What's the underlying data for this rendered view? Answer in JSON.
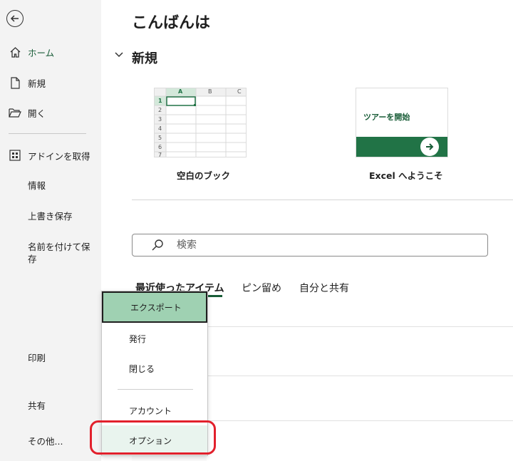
{
  "sidebar": {
    "home_label": "ホーム",
    "new_label": "新規",
    "open_label": "開く",
    "addins_label": "アドインを取得",
    "info_label": "情報",
    "save_label": "上書き保存",
    "save_as_label": "名前を付けて保存",
    "print_label": "印刷",
    "share_label": "共有",
    "more_label": "その他..."
  },
  "main": {
    "greeting": "こんばんは",
    "new_section_title": "新規",
    "templates": [
      {
        "label": "空白のブック"
      },
      {
        "label": "Excel へようこそ",
        "thumb_text": "ツアーを開始"
      }
    ],
    "sheet_columns": [
      "A",
      "B",
      "C"
    ],
    "sheet_rows": [
      "1",
      "2",
      "3",
      "4",
      "5",
      "6",
      "7"
    ],
    "search_placeholder": "検索",
    "tabs": [
      "最近使ったアイテム",
      "ピン留め",
      "自分と共有"
    ]
  },
  "menu": {
    "items": [
      "エクスポート",
      "発行",
      "閉じる",
      "アカウント",
      "オプション"
    ],
    "selected": "エクスポート"
  },
  "colors": {
    "accent": "#185c37",
    "selected_bg": "#9fd1b2",
    "annotation": "#e2202c"
  }
}
